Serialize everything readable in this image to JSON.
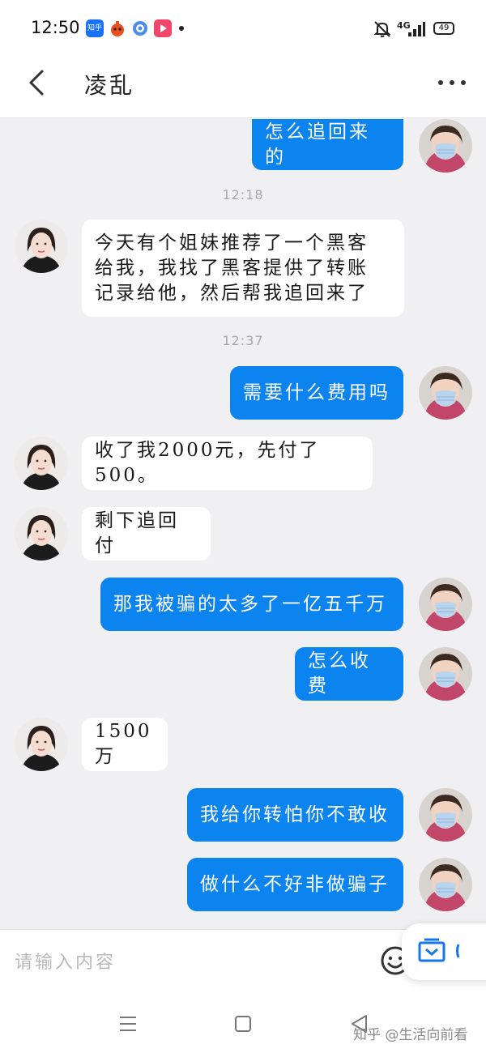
{
  "status_bar": {
    "time": "12:50",
    "app_icons": [
      "zhihu-app-icon",
      "game-app-icon",
      "browser-app-icon",
      "video-app-icon"
    ],
    "zhihu_icon_text": "知乎",
    "signal_text": "4G",
    "battery_level": "49"
  },
  "header": {
    "title": "凌乱"
  },
  "messages": [
    {
      "side": "out",
      "text": "怎么追回来的"
    },
    {
      "type": "time",
      "text": "12:18"
    },
    {
      "side": "in",
      "text": "今天有个姐妹推荐了一个黑客\n给我，我找了黑客提供了转账\n记录给他，然后帮我追回来了"
    },
    {
      "type": "time",
      "text": "12:37"
    },
    {
      "side": "out",
      "text": "需要什么费用吗"
    },
    {
      "side": "in",
      "text": "收了我2000元，先付了500。"
    },
    {
      "side": "in",
      "text": "剩下追回付"
    },
    {
      "side": "out",
      "text": "那我被骗的太多了一亿五千万"
    },
    {
      "side": "out",
      "text": "怎么收费"
    },
    {
      "side": "in",
      "text": "1500万"
    },
    {
      "side": "out",
      "text": "我给你转怕你不敢收"
    },
    {
      "side": "out",
      "text": "做什么不好非做骗子"
    }
  ],
  "input": {
    "placeholder": "请输入内容"
  },
  "watermark": "知乎 @生活向前看",
  "colors": {
    "outgoing_bubble": "#0b84f0",
    "incoming_bubble": "#ffffff",
    "chat_background": "#f0f0f2"
  }
}
